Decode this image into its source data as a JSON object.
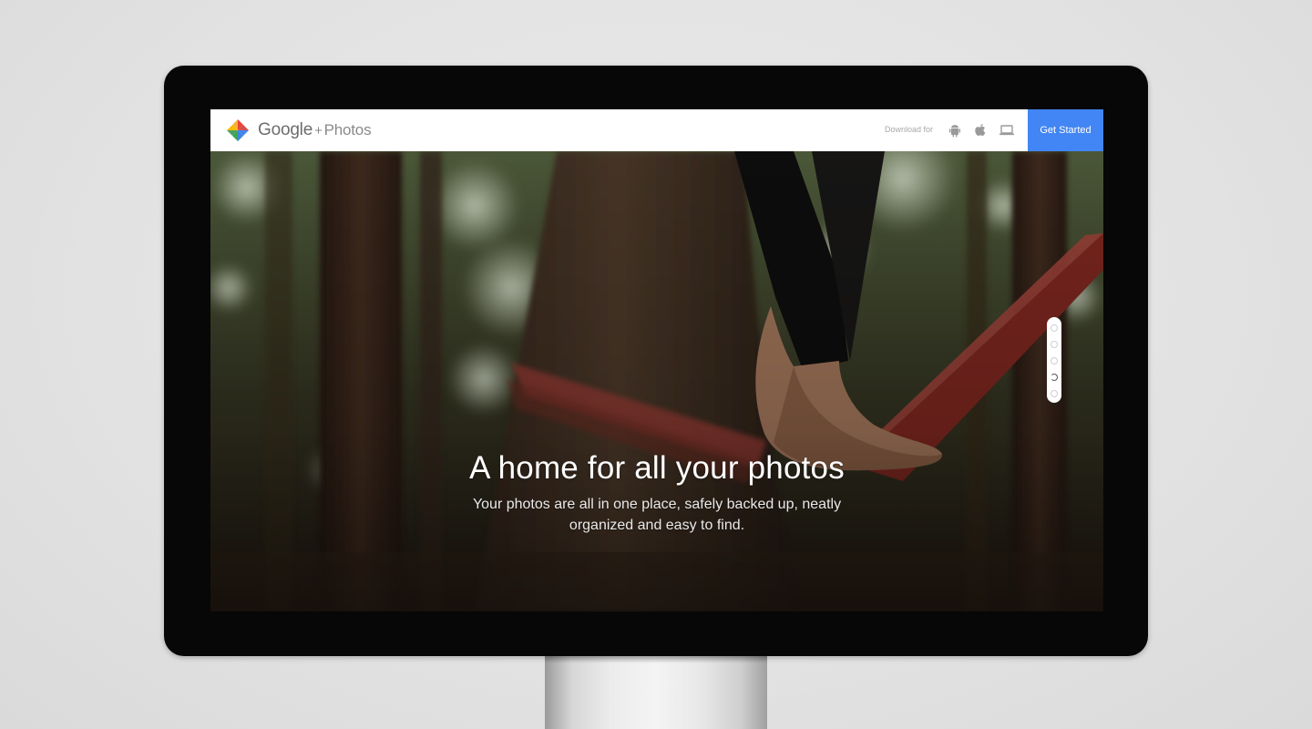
{
  "header": {
    "brand_google": "Google",
    "brand_plus": "+",
    "brand_photos": "Photos",
    "download_label": "Download for",
    "platforms": [
      "android-icon",
      "apple-icon",
      "laptop-icon"
    ],
    "cta_label": "Get Started",
    "cta_color": "#4285f4"
  },
  "hero": {
    "headline": "A home for all your photos",
    "subline": "Your photos are all in one place, safely backed up, neatly organized and easy to find."
  },
  "pager": {
    "count": 5,
    "active_index": 3
  }
}
